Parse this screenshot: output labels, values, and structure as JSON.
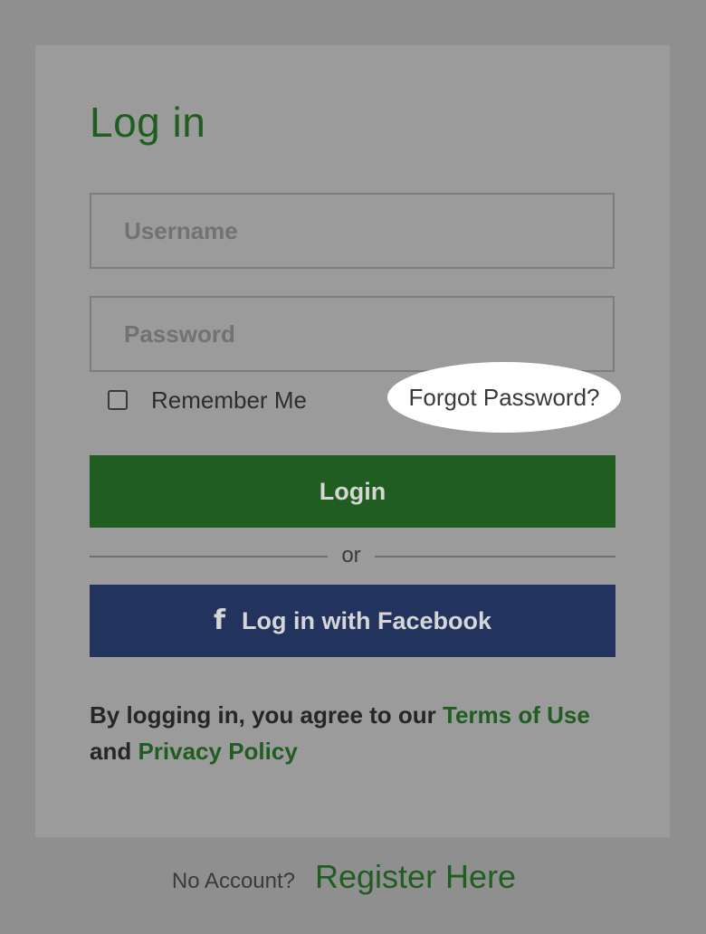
{
  "login": {
    "title": "Log in",
    "username_placeholder": "Username",
    "password_placeholder": "Password",
    "remember_label": "Remember Me",
    "remember_checked": false,
    "forgot_label": "Forgot Password?",
    "login_button": "Login",
    "divider_text": "or",
    "facebook_icon": "facebook-f-icon",
    "facebook_button": "Log in with Facebook",
    "agreement_text_1": "By logging in, you agree to our ",
    "terms_link": "Terms of Use",
    "agreement_text_2": "and ",
    "privacy_link": "Privacy Policy"
  },
  "footer": {
    "question": "No Account?",
    "register_link": "Register Here"
  },
  "colors": {
    "page_background": "#8f8f8f",
    "card_background": "#9b9b9b",
    "brand_green": "#1f5e20",
    "facebook_blue": "#22345d",
    "highlight": "#ffffff"
  }
}
